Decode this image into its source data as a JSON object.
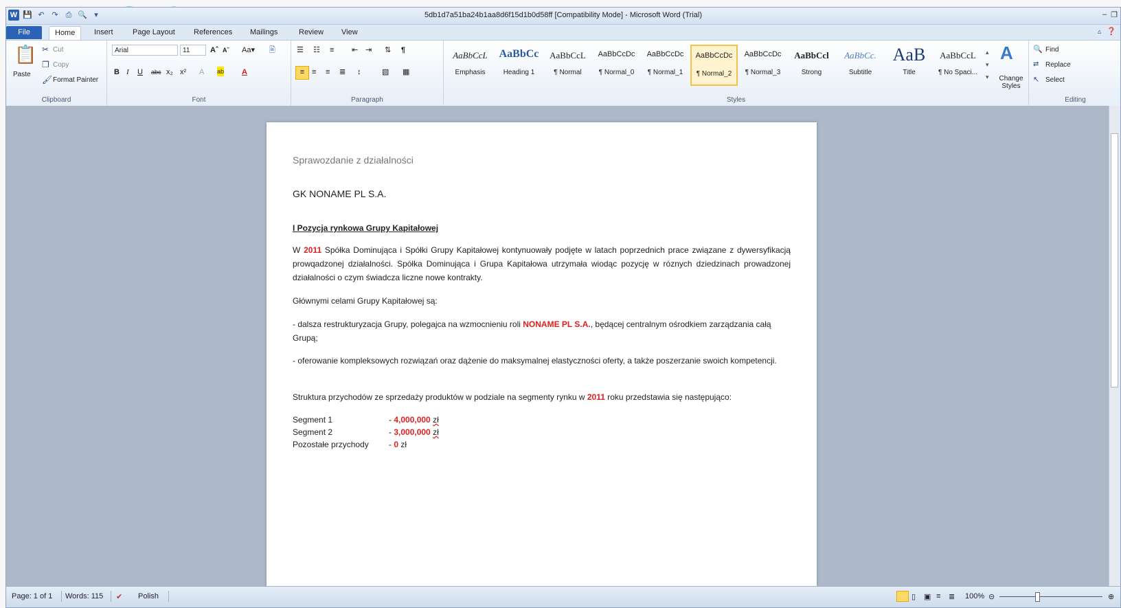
{
  "window": {
    "title": "5db1d7a51ba24b1aa8d6f15d1b0d58ff [Compatibility Mode]  -  Microsoft Word (Trial)",
    "qat_icons": [
      "word-icon",
      "save-icon",
      "undo-icon",
      "redo-icon",
      "print-icon",
      "print-preview-icon",
      "customize-icon"
    ]
  },
  "tabs": [
    "File",
    "Home",
    "Insert",
    "Page Layout",
    "References",
    "Mailings",
    "Review",
    "View"
  ],
  "ribbon": {
    "clipboard": {
      "paste": "Paste",
      "cut": "Cut",
      "copy": "Copy",
      "format_painter": "Format Painter",
      "label": "Clipboard"
    },
    "font": {
      "name": "Arial",
      "size": "11",
      "label": "Font"
    },
    "paragraph": {
      "label": "Paragraph"
    },
    "styles": {
      "label": "Styles",
      "items": [
        {
          "sample": "AaBbCcL",
          "name": "Emphasis"
        },
        {
          "sample": "AaBbCc",
          "name": "Heading 1"
        },
        {
          "sample": "AaBbCcL",
          "name": "¶ Normal"
        },
        {
          "sample": "AaBbCcDc",
          "name": "¶ Normal_0"
        },
        {
          "sample": "AaBbCcDc",
          "name": "¶ Normal_1"
        },
        {
          "sample": "AaBbCcDc",
          "name": "¶ Normal_2"
        },
        {
          "sample": "AaBbCcDc",
          "name": "¶ Normal_3"
        },
        {
          "sample": "AaBbCcl",
          "name": "Strong"
        },
        {
          "sample": "AaBbCc.",
          "name": "Subtitle"
        },
        {
          "sample": "AaB",
          "name": "Title"
        },
        {
          "sample": "AaBbCcL",
          "name": "¶ No Spaci..."
        }
      ],
      "change_styles": "Change Styles"
    },
    "editing": {
      "find": "Find",
      "replace": "Replace",
      "select": "Select",
      "label": "Editing"
    }
  },
  "document": {
    "header": "Sprawozdanie z działalności",
    "company": "GK NONAME  PL S.A.",
    "section_title": "I Pozycja rynkowa  Grupy Kapitałowej",
    "para1_pre": "W ",
    "year": "2011",
    "para1_post": " Spółka Dominująca i Spółki Grupy Kapitałowej kontynuowały podjęte w latach poprzednich prace związane z dywersyfikacją prowqadzonej działalności. Spółka Dominująca i Grupa Kapitałowa utrzymała wiodąc pozycję w róznych dziedzinach prowadzonej działalności o czym świadcza liczne nowe kontrakty.",
    "goals_intro": "Głównymi celami Grupy Kapitałowej są:",
    "goal1_pre": "- dalsza restrukturyzacja Grupy, polegajca na wzmocnieniu roli ",
    "goal1_company": "NONAME PL S.A.",
    "goal1_post": ", będącej centralnym ośrodkiem zarządzania całą Grupą;",
    "goal2": "- oferowanie kompleksowych rozwiązań oraz dążenie do maksymalnej elastyczności oferty, a także poszerzanie swoich kompetencji.",
    "structure_pre": "Struktura przychodów ze sprzedaży produktów w podziale na segmenty rynku w ",
    "structure_year": "2011",
    "structure_post": " roku przedstawia się następująco:",
    "segments": [
      {
        "name": "Segment 1",
        "dash": "- ",
        "value": "4,000,000",
        "unit": "zł"
      },
      {
        "name": "Segment 2",
        "dash": "- ",
        "value": "3,000,000",
        "unit": "zł"
      },
      {
        "name": "Pozostałe przychody",
        "dash": "- ",
        "value": "0",
        "unit": "zł"
      }
    ]
  },
  "status": {
    "page": "Page: 1 of 1",
    "words": "Words: 115",
    "language": "Polish",
    "zoom": "100%"
  }
}
